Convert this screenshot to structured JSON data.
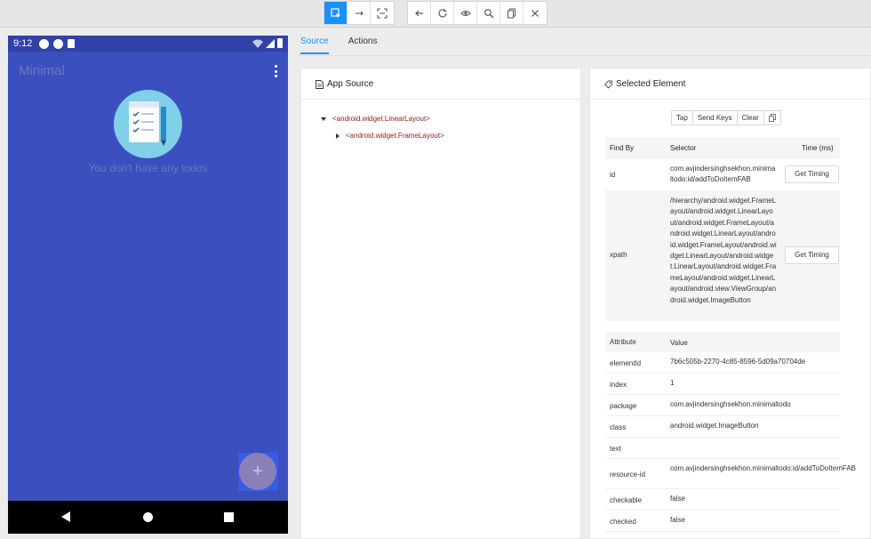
{
  "phone": {
    "time": "9:12",
    "app_title": "Minimal",
    "empty_message": "You don't have any todos",
    "fab_label": "+"
  },
  "tabs": [
    {
      "label": "Source"
    },
    {
      "label": "Actions"
    }
  ],
  "source": {
    "title": "App Source",
    "tree": [
      {
        "label": "<android.widget.LinearLayout>"
      },
      {
        "label": "<android.widget.FrameLayout>"
      }
    ]
  },
  "selected": {
    "title": "Selected Element",
    "actions": {
      "tap": "Tap",
      "send_keys": "Send Keys",
      "clear": "Clear"
    },
    "table_headers": {
      "find_by": "Find By",
      "selector": "Selector",
      "time": "Time (ms)"
    },
    "selectors": [
      {
        "find_by": "id",
        "selector": "com.avjindersinghsekhon.minimaltodo:id/addToDoItemFAB",
        "button": "Get Timing"
      },
      {
        "find_by": "xpath",
        "selector": "/hierarchy/android.widget.FrameLayout/android.widget.LinearLayout/android.widget.FrameLayout/android.widget.LinearLayout/android.widget.FrameLayout/android.widget.LinearLayout/android.widget.LinearLayout/android.widget.FrameLayout/android.widget.LinearLayout/android.view.ViewGroup/android.widget.ImageButton",
        "button": "Get Timing"
      }
    ],
    "attr_headers": {
      "attribute": "Attribute",
      "value": "Value"
    },
    "attributes": [
      {
        "name": "elementId",
        "value": "7b6c505b-2270-4c85-8596-5d09a70704de"
      },
      {
        "name": "index",
        "value": "1"
      },
      {
        "name": "package",
        "value": "com.avjindersinghsekhon.minimaltodo"
      },
      {
        "name": "class",
        "value": "android.widget.ImageButton"
      },
      {
        "name": "text",
        "value": ""
      },
      {
        "name": "resource-id",
        "value": "com.avjindersinghsekhon.minimaltodo:id/addToDoItemFAB"
      },
      {
        "name": "checkable",
        "value": "false"
      },
      {
        "name": "checked",
        "value": "false"
      }
    ]
  }
}
